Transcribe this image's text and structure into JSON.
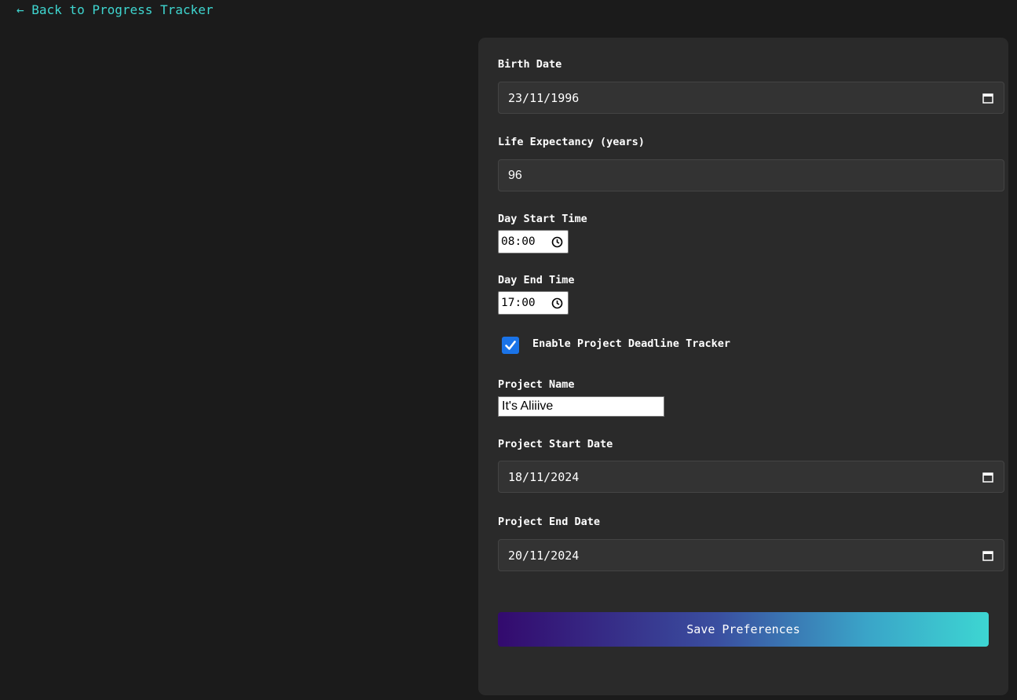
{
  "nav": {
    "back_label": "← Back to Progress Tracker"
  },
  "form": {
    "birth_date": {
      "label": "Birth Date",
      "value": "23/11/1996"
    },
    "life_expectancy": {
      "label": "Life Expectancy (years)",
      "value": "96"
    },
    "day_start_time": {
      "label": "Day Start Time",
      "value": "08:00"
    },
    "day_end_time": {
      "label": "Day End Time",
      "value": "17:00"
    },
    "project_tracker": {
      "label": "Enable Project Deadline Tracker",
      "checked": true
    },
    "project_name": {
      "label": "Project Name",
      "value": "It's Aliiive"
    },
    "project_start_date": {
      "label": "Project Start Date",
      "value": "18/11/2024"
    },
    "project_end_date": {
      "label": "Project End Date",
      "value": "20/11/2024"
    },
    "save_label": "Save Preferences"
  },
  "colors": {
    "accent": "#3fd6d0",
    "checkbox": "#1a73e8",
    "background": "#1b1b1b",
    "panel": "#2a2a2a"
  },
  "icons": {
    "date": "calendar-icon",
    "time": "clock-icon",
    "check": "checkmark-icon"
  }
}
